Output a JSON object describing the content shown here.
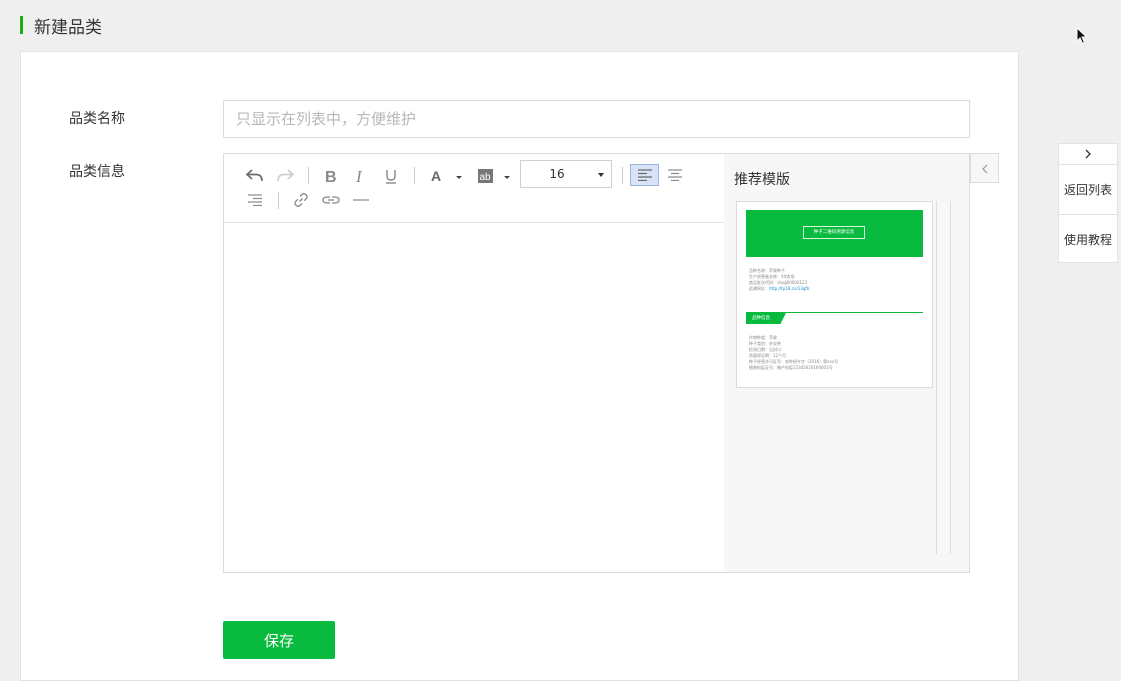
{
  "page": {
    "title": "新建品类"
  },
  "form": {
    "name_label": "品类名称",
    "name_placeholder": "只显示在列表中，方便维护",
    "name_value": "",
    "info_label": "品类信息"
  },
  "editor": {
    "font_size": "16",
    "toolbar_icons": [
      "undo-icon",
      "redo-icon",
      "bold-icon",
      "italic-icon",
      "underline-icon",
      "font-color-icon",
      "background-color-icon",
      "align-left-icon",
      "align-center-icon",
      "align-right-icon",
      "link-icon",
      "unlink-icon",
      "horizontal-rule-icon"
    ]
  },
  "template": {
    "title": "推荐模版",
    "banner_text": "种子二维码溯源信息",
    "lines1": [
      "品种名称：苹果种子",
      "生产经营者名称：XX农场",
      "商品批次代码：cbyg00000123",
      "追溯网址："
    ],
    "url": "http://tp18.cn/13gfb",
    "section_tag": "品种信息",
    "lines2": [
      "作物种类：苹果",
      "种子类别：杂交种",
      "检测日期：见封口",
      "质量保证期：12个月",
      "种子经营许可证号：农种经许字（2016）第xxx号",
      "植物检疫证号：粮产检疫12345620160001号"
    ]
  },
  "actions": {
    "save_label": "保存"
  },
  "side_nav": {
    "items": [
      "返回列表",
      "使用教程"
    ]
  },
  "colors": {
    "accent": "#08bb3f",
    "title_bar": "#1aad19"
  }
}
